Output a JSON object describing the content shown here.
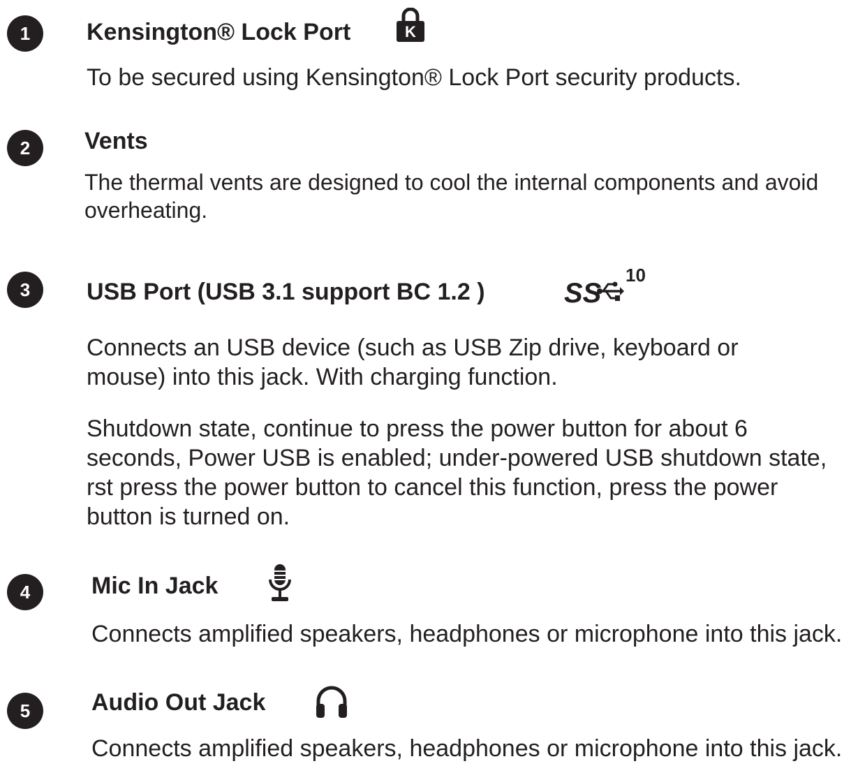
{
  "items": [
    {
      "number": "1",
      "title": "Kensington® Lock Port",
      "icon": "kensington-lock-icon",
      "icon_letter": "K",
      "paragraphs": [
        "To be secured using Kensington® Lock Port security products."
      ]
    },
    {
      "number": "2",
      "title": "Vents",
      "paragraphs": [
        "The thermal vents are designed to cool the internal components and avoid overheating."
      ]
    },
    {
      "number": "3",
      "title": "USB Port (USB 3.1 support BC 1.2 )",
      "icon": "usb-superspeed-10-icon",
      "icon_text": "SS",
      "icon_superscript": "10",
      "paragraphs": [
        "Connects an USB device (such as USB Zip drive, keyboard or mouse) into this jack. With charging function.",
        "Shutdown state, continue to press the power button for about 6 seconds, Power USB is enabled; under-powered USB shutdown state,  rst press the power button to cancel this function, press the power button is turned on."
      ]
    },
    {
      "number": "4",
      "title": "Mic In Jack",
      "icon": "microphone-icon",
      "paragraphs": [
        "Connects amplified speakers, headphones or microphone into this jack."
      ]
    },
    {
      "number": "5",
      "title": "Audio Out Jack",
      "icon": "headphones-icon",
      "paragraphs": [
        "Connects amplified speakers, headphones or microphone into this jack."
      ]
    }
  ],
  "colors": {
    "text": "#231f20",
    "badge_background": "#231f20",
    "badge_text": "#ffffff"
  }
}
